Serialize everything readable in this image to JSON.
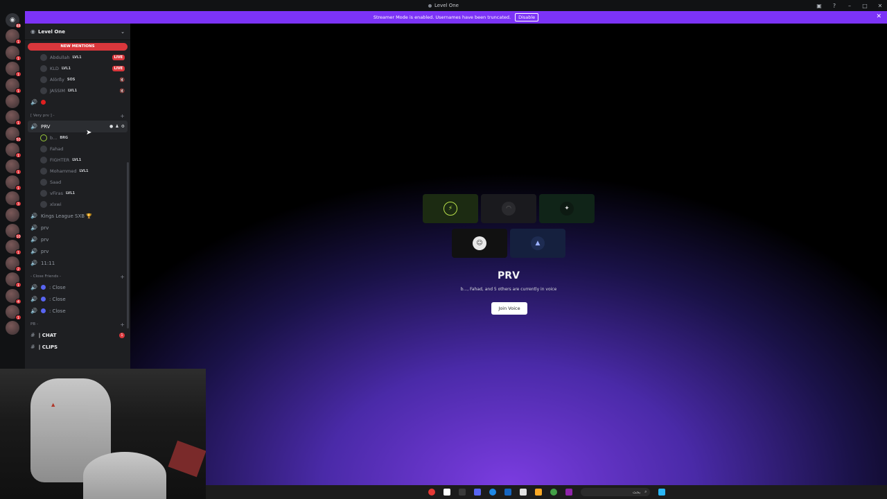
{
  "window": {
    "title": "Level One"
  },
  "banner": {
    "text": "Streamer Mode is enabled. Usernames have been truncated.",
    "button": "Disable"
  },
  "guild": {
    "name": "Level One"
  },
  "mentions_pill": "NEW MENTIONS",
  "voice_users_top": [
    {
      "name": "Abdullah",
      "tag": "LVL1",
      "status": "live"
    },
    {
      "name": "KLD",
      "tag": "LVL1",
      "status": "live"
    },
    {
      "name": "Alörßy",
      "tag": "SOS",
      "status": "muted"
    },
    {
      "name": "JASSIM",
      "tag": "LVL1",
      "status": "muted"
    }
  ],
  "category_very_prv": "[ Very prv ] -",
  "active_channel": {
    "name": "PRV"
  },
  "prv_users": [
    {
      "name": "b...",
      "tag": "BRG"
    },
    {
      "name": "Fahad",
      "tag": ""
    },
    {
      "name": "FIGHTER",
      "tag": "LVL1"
    },
    {
      "name": "Mohammed",
      "tag": "LVL1"
    },
    {
      "name": "Saad",
      "tag": ""
    },
    {
      "name": "vFiras",
      "tag": "LVL1"
    },
    {
      "name": "xlxwi",
      "tag": ""
    }
  ],
  "voice_channels": [
    "Kings League SXB 🏆",
    "prv",
    "prv",
    "prv",
    "11:11"
  ],
  "category_close_friends": "- Close Friends -",
  "close_channels": [
    ": Close",
    ": Close",
    ": Close"
  ],
  "category_pb": "PB -",
  "text_channels": [
    {
      "name": "| CHAT",
      "badge": "1"
    },
    {
      "name": "| CLIPS",
      "badge": ""
    }
  ],
  "servers": [
    {
      "badge": "88",
      "home": true
    },
    {
      "badge": "1"
    },
    {
      "badge": "1"
    },
    {
      "badge": "1"
    },
    {
      "badge": "1"
    },
    {
      "badge": ""
    },
    {
      "badge": "1"
    },
    {
      "badge": "50"
    },
    {
      "badge": "1"
    },
    {
      "badge": "1"
    },
    {
      "badge": "1"
    },
    {
      "badge": "3"
    },
    {
      "badge": ""
    },
    {
      "badge": "10"
    },
    {
      "badge": "1"
    },
    {
      "badge": "2"
    },
    {
      "badge": "1"
    },
    {
      "badge": "4"
    },
    {
      "badge": "1"
    },
    {
      "badge": ""
    }
  ],
  "voice_call": {
    "title": "PRV",
    "subtitle": "b..., Fahad, and 5 others are currently in voice",
    "join_label": "Join Voice"
  },
  "taskbar": {
    "search_text": "بحث"
  },
  "colors": {
    "banner": "#7c33f7",
    "live": "#da373c",
    "accent": "#5865f2"
  }
}
